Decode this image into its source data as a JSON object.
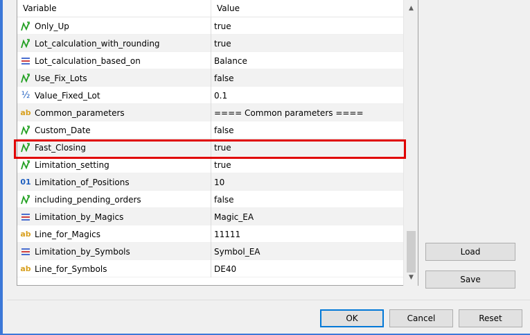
{
  "grid": {
    "headers": {
      "variable": "Variable",
      "value": "Value"
    },
    "rows": [
      {
        "icon": "bool-arrow-icon",
        "variable": "Only_Up",
        "value": "true"
      },
      {
        "icon": "bool-arrow-icon",
        "variable": "Lot_calculation_with_rounding",
        "value": "true"
      },
      {
        "icon": "enum-list-icon",
        "variable": "Lot_calculation_based_on",
        "value": "Balance"
      },
      {
        "icon": "bool-arrow-icon",
        "variable": "Use_Fix_Lots",
        "value": "false"
      },
      {
        "icon": "fraction-icon",
        "variable": "Value_Fixed_Lot",
        "value": "0.1"
      },
      {
        "icon": "string-ab-icon",
        "variable": "Common_parameters",
        "value": "==== Common parameters ===="
      },
      {
        "icon": "bool-arrow-icon",
        "variable": "Custom_Date",
        "value": "false"
      },
      {
        "icon": "bool-arrow-icon",
        "variable": "Fast_Closing",
        "value": "true"
      },
      {
        "icon": "bool-arrow-icon",
        "variable": "Limitation_setting",
        "value": "true"
      },
      {
        "icon": "integer-01-icon",
        "variable": "Limitation_of_Positions",
        "value": "10"
      },
      {
        "icon": "bool-arrow-icon",
        "variable": "including_pending_orders",
        "value": "false"
      },
      {
        "icon": "enum-list-icon",
        "variable": "Limitation_by_Magics",
        "value": "Magic_EA"
      },
      {
        "icon": "string-ab-icon",
        "variable": "Line_for_Magics",
        "value": "11111"
      },
      {
        "icon": "enum-list-icon",
        "variable": "Limitation_by_Symbols",
        "value": "Symbol_EA"
      },
      {
        "icon": "string-ab-icon",
        "variable": "Line_for_Symbols",
        "value": "DE40"
      }
    ],
    "highlighted_row": "Fast_Closing"
  },
  "icons": {
    "string_glyph": "ab",
    "integer_glyph": "01",
    "fraction_glyph": "½"
  },
  "buttons": {
    "load": "Load",
    "save": "Save",
    "ok": "OK",
    "cancel": "Cancel",
    "reset": "Reset"
  },
  "colors": {
    "highlight": "#e00000",
    "bool_icon": "#22a022",
    "enum_icon": "#4a6fd0"
  }
}
